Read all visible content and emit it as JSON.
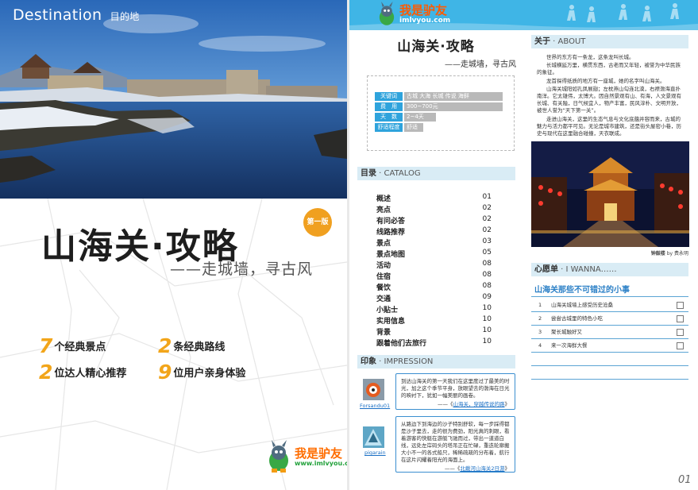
{
  "cover": {
    "destination_en": "Destination",
    "destination_zh": "目的地",
    "title": "山海关·攻略",
    "edition_badge": "第一版",
    "subtitle": "——走城墙，寻古风",
    "features": [
      {
        "num": "7",
        "text": "个经典景点"
      },
      {
        "num": "2",
        "text": "条经典路线"
      },
      {
        "num": "2",
        "text": "位达人精心推荐"
      },
      {
        "num": "9",
        "text": "位用户亲身体验"
      }
    ],
    "logo_name": "我是驴友",
    "logo_url": "www.imlvyou.com"
  },
  "guide": {
    "title": "山海关·攻略",
    "subtitle": "——走城墙，寻古风",
    "info": [
      {
        "key": "关键词",
        "value": "古城 大海 长城 传说 海鲜"
      },
      {
        "key": "费　用",
        "value": "300~700元"
      },
      {
        "key": "天　数",
        "value": "2~4天"
      },
      {
        "key": "舒适程度",
        "value": "舒适"
      }
    ],
    "catalog_header_zh": "目录",
    "catalog_header_en": "CATALOG",
    "toc": [
      {
        "label": "概述",
        "page": "01"
      },
      {
        "label": "亮点",
        "page": "02"
      },
      {
        "label": "有问必答",
        "page": "02"
      },
      {
        "label": "线路推荐",
        "page": "02"
      },
      {
        "label": "景点",
        "page": "03"
      },
      {
        "label": "景点地图",
        "page": "05"
      },
      {
        "label": "活动",
        "page": "08"
      },
      {
        "label": "住宿",
        "page": "08"
      },
      {
        "label": "餐饮",
        "page": "08"
      },
      {
        "label": "交通",
        "page": "09"
      },
      {
        "label": "小贴士",
        "page": "10"
      },
      {
        "label": "实用信息",
        "page": "10"
      },
      {
        "label": "背景",
        "page": "10"
      },
      {
        "label": "跟着他们去旅行",
        "page": "10"
      }
    ],
    "impression_header_zh": "印象",
    "impression_header_en": "IMPRESSION",
    "impressions": [
      {
        "user": "Forsandu01",
        "text": "到达山海关的第一天我们在这里度过了最美的时光，加之这个季节平身，放眼望去的渤海在日光的映衬下，犹如一幅美丽的画卷。",
        "source_prefix": "——《",
        "source": "山海关，穿越传说的路",
        "source_suffix": "》"
      },
      {
        "user": "pigarain",
        "text": "从路边下到海边的沙子特别舒软，每一步踩得都是沙子里去，走的很为费劲，阳光真的刺眼，看着游客的快艇在游艇飞驰而过，带出一道道白线，远处左岸码头的塔吊正在忙碌，重迭轮廓搬大小不一的各式船只，稀稀疏疏的分布着，航行在这片闪耀着阳光的海面上。",
        "source_prefix": "——《",
        "source": "北戴河山海关2日游",
        "source_suffix": "》"
      }
    ],
    "about_header_zh": "关于",
    "about_header_en": "ABOUT",
    "about": [
      "世界的东方有一条龙，这条龙叫长城。",
      "长城横延万里，横贯东西，古老而又年轻，被誉为中华民族的象征。",
      "龙首探得纸质的地方有一座城，她的名字叫山海关。",
      "山海关城阳如孔凤展翅；左枕燕山勾连北漠，右襟渤海直扑南洋。它太雄伟，太博大。因自然景观有山、有海，人文景观有长城、有关隘，日气候宜人，物产丰富，民风淳朴、文明开放，被世人誉为“天下第一关”。",
      "走进山海关，这里的生态气息与文化底蕴并容而来，古城的魅力与活力都平可见。无论是城市建筑，还是街头屋密小巷，历史与现代在这里融合碰撞，天衣联成。"
    ],
    "photo_caption_title": "钟鼓楼",
    "photo_caption_by": "by 费永明",
    "wish_header_zh": "心愿单",
    "wish_header_en": "I WANNA……",
    "wish_title": "山海关那些不可错过的小事",
    "wishes": [
      {
        "num": "1",
        "text": "山海关城墙上感受历史沧桑"
      },
      {
        "num": "2",
        "text": "尝尝古城里的特色小吃"
      },
      {
        "num": "3",
        "text": "聚长城触好又"
      },
      {
        "num": "4",
        "text": "来一次海鲜大餐"
      }
    ],
    "page_number": "01",
    "logo_name": "我是驴友",
    "logo_url": "imlvyou.com"
  },
  "colors": {
    "accent_blue": "#3fb5e6",
    "accent_orange": "#f2a51a",
    "section_bg": "#d9ecf5"
  }
}
